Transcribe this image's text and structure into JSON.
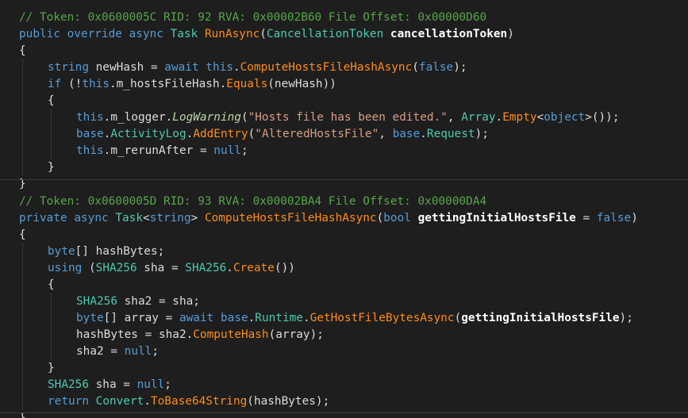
{
  "block1": {
    "lines": [
      {
        "indent": 0,
        "tokens": [
          {
            "c": "cm",
            "t": "// Token: 0x0600005C RID: 92 RVA: 0x00002B60 File Offset: 0x00000D60"
          }
        ]
      },
      {
        "indent": 0,
        "tokens": [
          {
            "c": "kw",
            "t": "public"
          },
          {
            "c": "id",
            "t": " "
          },
          {
            "c": "kw",
            "t": "override"
          },
          {
            "c": "id",
            "t": " "
          },
          {
            "c": "kw",
            "t": "async"
          },
          {
            "c": "id",
            "t": " "
          },
          {
            "c": "ty",
            "t": "Task"
          },
          {
            "c": "id",
            "t": " "
          },
          {
            "c": "fn",
            "t": "RunAsync"
          },
          {
            "c": "id",
            "t": "("
          },
          {
            "c": "ty",
            "t": "CancellationToken"
          },
          {
            "c": "id",
            "t": " "
          },
          {
            "c": "pm",
            "t": "cancellationToken"
          },
          {
            "c": "id",
            "t": ")"
          }
        ]
      },
      {
        "indent": 0,
        "tokens": [
          {
            "c": "id",
            "t": "{"
          }
        ]
      },
      {
        "indent": 1,
        "tokens": [
          {
            "c": "kw",
            "t": "string"
          },
          {
            "c": "id",
            "t": " newHash = "
          },
          {
            "c": "kw",
            "t": "await"
          },
          {
            "c": "id",
            "t": " "
          },
          {
            "c": "kw",
            "t": "this"
          },
          {
            "c": "id",
            "t": "."
          },
          {
            "c": "fn",
            "t": "ComputeHostsFileHashAsync"
          },
          {
            "c": "id",
            "t": "("
          },
          {
            "c": "kw",
            "t": "false"
          },
          {
            "c": "id",
            "t": ");"
          }
        ]
      },
      {
        "indent": 1,
        "tokens": [
          {
            "c": "kw",
            "t": "if"
          },
          {
            "c": "id",
            "t": " (!"
          },
          {
            "c": "kw",
            "t": "this"
          },
          {
            "c": "id",
            "t": ".m_hostsFileHash."
          },
          {
            "c": "fn",
            "t": "Equals"
          },
          {
            "c": "id",
            "t": "(newHash))"
          }
        ]
      },
      {
        "indent": 1,
        "tokens": [
          {
            "c": "id",
            "t": "{"
          }
        ]
      },
      {
        "indent": 2,
        "tokens": [
          {
            "c": "kw",
            "t": "this"
          },
          {
            "c": "id",
            "t": ".m_logger."
          },
          {
            "c": "ev",
            "t": "LogWarning"
          },
          {
            "c": "id",
            "t": "("
          },
          {
            "c": "st",
            "t": "\"Hosts file has been edited.\""
          },
          {
            "c": "id",
            "t": ", "
          },
          {
            "c": "ty",
            "t": "Array"
          },
          {
            "c": "id",
            "t": "."
          },
          {
            "c": "fn",
            "t": "Empty"
          },
          {
            "c": "id",
            "t": "<"
          },
          {
            "c": "kw",
            "t": "object"
          },
          {
            "c": "id",
            "t": ">());"
          }
        ]
      },
      {
        "indent": 2,
        "tokens": [
          {
            "c": "kw",
            "t": "base"
          },
          {
            "c": "id",
            "t": "."
          },
          {
            "c": "ty",
            "t": "ActivityLog"
          },
          {
            "c": "id",
            "t": "."
          },
          {
            "c": "fn",
            "t": "AddEntry"
          },
          {
            "c": "id",
            "t": "("
          },
          {
            "c": "st",
            "t": "\"AlteredHostsFile\""
          },
          {
            "c": "id",
            "t": ", "
          },
          {
            "c": "kw",
            "t": "base"
          },
          {
            "c": "id",
            "t": "."
          },
          {
            "c": "ty",
            "t": "Request"
          },
          {
            "c": "id",
            "t": ");"
          }
        ]
      },
      {
        "indent": 2,
        "tokens": [
          {
            "c": "kw",
            "t": "this"
          },
          {
            "c": "id",
            "t": ".m_rerunAfter = "
          },
          {
            "c": "kw",
            "t": "null"
          },
          {
            "c": "id",
            "t": ";"
          }
        ]
      },
      {
        "indent": 1,
        "tokens": [
          {
            "c": "id",
            "t": "}"
          }
        ]
      },
      {
        "indent": 0,
        "tokens": [
          {
            "c": "id",
            "t": "}"
          }
        ]
      }
    ]
  },
  "block2": {
    "lines": [
      {
        "indent": 0,
        "tokens": [
          {
            "c": "cm",
            "t": "// Token: 0x0600005D RID: 93 RVA: 0x00002BA4 File Offset: 0x00000DA4"
          }
        ]
      },
      {
        "indent": 0,
        "tokens": [
          {
            "c": "kw",
            "t": "private"
          },
          {
            "c": "id",
            "t": " "
          },
          {
            "c": "kw",
            "t": "async"
          },
          {
            "c": "id",
            "t": " "
          },
          {
            "c": "ty",
            "t": "Task"
          },
          {
            "c": "id",
            "t": "<"
          },
          {
            "c": "kw",
            "t": "string"
          },
          {
            "c": "id",
            "t": "> "
          },
          {
            "c": "fn",
            "t": "ComputeHostsFileHashAsync"
          },
          {
            "c": "id",
            "t": "("
          },
          {
            "c": "kw",
            "t": "bool"
          },
          {
            "c": "id",
            "t": " "
          },
          {
            "c": "pm",
            "t": "gettingInitialHostsFile"
          },
          {
            "c": "id",
            "t": " = "
          },
          {
            "c": "kw",
            "t": "false"
          },
          {
            "c": "id",
            "t": ")"
          }
        ]
      },
      {
        "indent": 0,
        "tokens": [
          {
            "c": "id",
            "t": "{"
          }
        ]
      },
      {
        "indent": 1,
        "tokens": [
          {
            "c": "kw",
            "t": "byte"
          },
          {
            "c": "id",
            "t": "[] hashBytes;"
          }
        ]
      },
      {
        "indent": 1,
        "tokens": [
          {
            "c": "kw",
            "t": "using"
          },
          {
            "c": "id",
            "t": " ("
          },
          {
            "c": "ty",
            "t": "SHA256"
          },
          {
            "c": "id",
            "t": " sha = "
          },
          {
            "c": "ty",
            "t": "SHA256"
          },
          {
            "c": "id",
            "t": "."
          },
          {
            "c": "fn",
            "t": "Create"
          },
          {
            "c": "id",
            "t": "())"
          }
        ]
      },
      {
        "indent": 1,
        "tokens": [
          {
            "c": "id",
            "t": "{"
          }
        ]
      },
      {
        "indent": 2,
        "tokens": [
          {
            "c": "ty",
            "t": "SHA256"
          },
          {
            "c": "id",
            "t": " sha2 = sha;"
          }
        ]
      },
      {
        "indent": 2,
        "tokens": [
          {
            "c": "kw",
            "t": "byte"
          },
          {
            "c": "id",
            "t": "[] array = "
          },
          {
            "c": "kw",
            "t": "await"
          },
          {
            "c": "id",
            "t": " "
          },
          {
            "c": "kw",
            "t": "base"
          },
          {
            "c": "id",
            "t": "."
          },
          {
            "c": "ty",
            "t": "Runtime"
          },
          {
            "c": "id",
            "t": "."
          },
          {
            "c": "fn",
            "t": "GetHostFileBytesAsync"
          },
          {
            "c": "id",
            "t": "("
          },
          {
            "c": "pm",
            "t": "gettingInitialHostsFile"
          },
          {
            "c": "id",
            "t": ");"
          }
        ]
      },
      {
        "indent": 2,
        "tokens": [
          {
            "c": "id",
            "t": "hashBytes = sha2."
          },
          {
            "c": "fn",
            "t": "ComputeHash"
          },
          {
            "c": "id",
            "t": "(array);"
          }
        ]
      },
      {
        "indent": 2,
        "tokens": [
          {
            "c": "id",
            "t": "sha2 = "
          },
          {
            "c": "kw",
            "t": "null"
          },
          {
            "c": "id",
            "t": ";"
          }
        ]
      },
      {
        "indent": 1,
        "tokens": [
          {
            "c": "id",
            "t": "}"
          }
        ]
      },
      {
        "indent": 1,
        "tokens": [
          {
            "c": "ty",
            "t": "SHA256"
          },
          {
            "c": "id",
            "t": " sha = "
          },
          {
            "c": "kw",
            "t": "null"
          },
          {
            "c": "id",
            "t": ";"
          }
        ]
      },
      {
        "indent": 1,
        "tokens": [
          {
            "c": "kw",
            "t": "return"
          },
          {
            "c": "id",
            "t": " "
          },
          {
            "c": "ty",
            "t": "Convert"
          },
          {
            "c": "id",
            "t": "."
          },
          {
            "c": "fn",
            "t": "ToBase64String"
          },
          {
            "c": "id",
            "t": "(hashBytes);"
          }
        ]
      },
      {
        "indent": 0,
        "tokens": [
          {
            "c": "id",
            "t": "}"
          }
        ]
      }
    ]
  },
  "colors": {
    "background": "#1e1e1e",
    "comment": "#57a64a",
    "keyword": "#569cd6",
    "type": "#4ec9b0",
    "method": "#ff8c1a",
    "string": "#d69d85",
    "parameter": "#ffffff",
    "text": "#dcdcdc"
  }
}
